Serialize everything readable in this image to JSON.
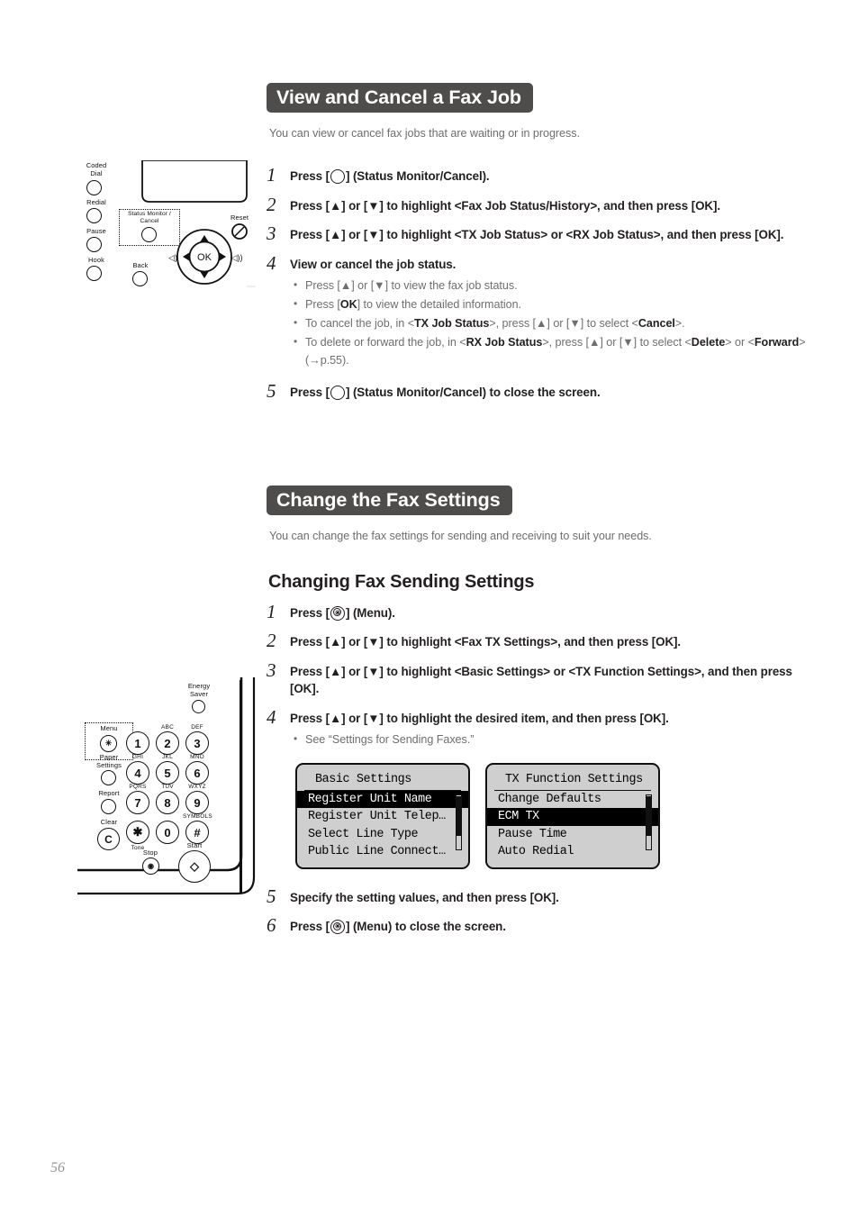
{
  "page": {
    "number": "56"
  },
  "sections": [
    {
      "id": "view-cancel-fax-job",
      "title": "View and Cancel a Fax Job",
      "intro": "You can view or cancel fax jobs that are waiting or in progress.",
      "steps": [
        {
          "num": "1",
          "text_before": "Press [",
          "icon": "status-monitor-ring-icon",
          "text_after": "] (Status Monitor/Cancel)."
        },
        {
          "num": "2",
          "text": "Press [▲] or [▼] to highlight <Fax Job Status/History>, and then press [OK]."
        },
        {
          "num": "3",
          "text": "Press [▲] or [▼] to highlight <TX Job Status> or <RX Job Status>, and then press [OK]."
        },
        {
          "num": "4",
          "text": "View or cancel the job status."
        },
        {
          "num": "5",
          "text_before": "Press [",
          "icon": "status-monitor-ring-icon",
          "text_after": "] (Status Monitor/Cancel) to close the screen."
        }
      ],
      "step4_bullets": [
        "Press [▲] or [▼] to view the fax job status.",
        "Press [OK] to view the detailed information.",
        "To cancel the job, in <TX Job Status>, press [▲] or [▼] to select <Cancel>.",
        "To delete or forward the job, in <RX Job Status>, press [▲] or [▼] to select <Delete> or <Forward> (→p.55)."
      ]
    },
    {
      "id": "change-fax-settings",
      "title": "Change the Fax Settings",
      "intro": "You can change the fax settings for sending and receiving to suit your needs.",
      "subheading": "Changing Fax Sending Settings",
      "steps": [
        {
          "num": "1",
          "text_before": "Press [",
          "icon": "menu-key-icon",
          "text_after": "] (Menu)."
        },
        {
          "num": "2",
          "text": "Press [▲] or [▼] to highlight <Fax TX Settings>, and then press [OK]."
        },
        {
          "num": "3",
          "text": "Press [▲] or [▼] to highlight <Basic Settings> or <TX Function Settings>, and then press [OK]."
        },
        {
          "num": "4",
          "text": "Press [▲] or [▼] to highlight the desired item, and then press [OK]."
        },
        {
          "num": "5",
          "text": "Specify the setting values, and then press [OK]."
        },
        {
          "num": "6",
          "text_before": "Press [",
          "icon": "menu-key-icon",
          "text_after": "] (Menu) to close the screen."
        }
      ],
      "step4_bullets": [
        "See “Settings for Sending Faxes.”"
      ]
    }
  ],
  "lcd_screens": [
    {
      "title": "Basic Settings",
      "items": [
        {
          "label": "Register Unit Name",
          "selected": true
        },
        {
          "label": "Register Unit Telep…",
          "selected": false
        },
        {
          "label": "Select Line Type",
          "selected": false
        },
        {
          "label": "Public Line Connect…",
          "selected": false
        }
      ],
      "scrollbar": {
        "thumb_top_pct": 0,
        "thumb_height_pct": 72
      }
    },
    {
      "title": "TX Function Settings",
      "items": [
        {
          "label": "Change Defaults",
          "selected": false
        },
        {
          "label": "ECM TX",
          "selected": true
        },
        {
          "label": "Pause Time",
          "selected": false
        },
        {
          "label": "Auto Redial",
          "selected": false
        }
      ],
      "scrollbar": {
        "thumb_top_pct": 0,
        "thumb_height_pct": 72
      }
    }
  ],
  "illustrations": {
    "top_panel": {
      "name": "control-panel-status-monitor",
      "labels": {
        "coded_dial": "Coded\nDial",
        "redial": "Redial",
        "pause": "Pause",
        "hook": "Hook",
        "status_monitor": "Status Monitor /\nCancel",
        "back": "Back",
        "reset": "Reset",
        "ok": "OK"
      }
    },
    "bottom_panel": {
      "name": "control-panel-keypad",
      "labels": {
        "energy_saver": "Energy\nSaver",
        "menu": "Menu",
        "paper_settings": "Paper\nSettings",
        "report": "Report",
        "clear": "Clear",
        "tone": "Tone",
        "stop": "Stop",
        "start": "Start"
      },
      "keys": [
        {
          "digit": "1",
          "letters": ""
        },
        {
          "digit": "2",
          "letters": "ABC"
        },
        {
          "digit": "3",
          "letters": "DEF"
        },
        {
          "digit": "4",
          "letters": "GHI"
        },
        {
          "digit": "5",
          "letters": "JKL"
        },
        {
          "digit": "6",
          "letters": "MNO"
        },
        {
          "digit": "7",
          "letters": "PQRS"
        },
        {
          "digit": "8",
          "letters": "TUV"
        },
        {
          "digit": "9",
          "letters": "WXYZ"
        },
        {
          "digit": "✱",
          "letters": ""
        },
        {
          "digit": "0",
          "letters": ""
        },
        {
          "digit": "#",
          "letters": "SYMBOLS"
        }
      ],
      "clear_key": "C"
    }
  },
  "colors": {
    "header_bar": "#4f4c4c",
    "body_text": "#231f20",
    "muted_text": "#6d6e71",
    "rule": "#9a9a9a",
    "lcd_background": "#cfcfcf",
    "page_number": "#939598"
  }
}
